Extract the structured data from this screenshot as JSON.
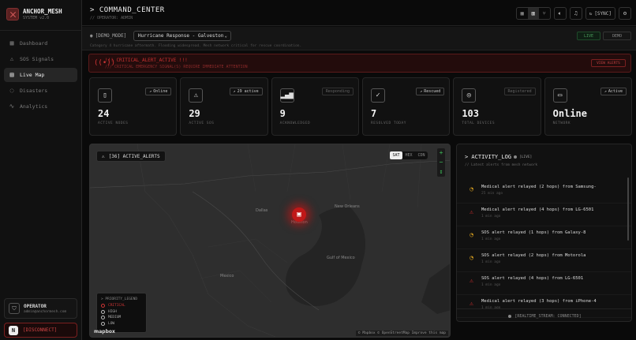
{
  "brand": {
    "name": "ANCHOR_MESH",
    "sub": "SYSTEM v2.0"
  },
  "nav": [
    {
      "label": "Dashboard",
      "icon": "grid-icon"
    },
    {
      "label": "SOS Signals",
      "icon": "warning-icon"
    },
    {
      "label": "Live Map",
      "icon": "map-icon"
    },
    {
      "label": "Disasters",
      "icon": "alert-circle-icon"
    },
    {
      "label": "Analytics",
      "icon": "activity-icon"
    }
  ],
  "operator": {
    "name": "OPERATOR",
    "email": "admin@anchormesh.com"
  },
  "disconnect": {
    "label": "[DISCONNECT]",
    "avatar": "N"
  },
  "header": {
    "title": "> COMMAND_CENTER",
    "subtitle": "// OPERATOR: ADMIN",
    "sync_label": "[SYNC]"
  },
  "demo": {
    "label": "[DEMO_MODE]",
    "selected": "Hurricane Response - Galveston",
    "description": "Category 4 hurricane aftermath. Flooding widespread. Mesh network critical for rescue coordination.",
    "live_label": "LIVE",
    "demo_btn": "DEMO"
  },
  "critical_alert": {
    "title": "!!! CRITICAL_ALERT_ACTIVE !!!",
    "subtitle": "/// CRITICAL EMERGENCY SIGNAL(S) REQUIRE IMMEDIATE ATTENTION",
    "button": "VIEW ALERTS"
  },
  "stats": [
    {
      "value": "24",
      "label": "ACTIVE NODES",
      "badge": "Online",
      "badge_dim": false,
      "icon": "phone-icon",
      "glyph": "▯"
    },
    {
      "value": "29",
      "label": "ACTIVE SOS",
      "badge": "29 active",
      "badge_dim": false,
      "icon": "warning-icon",
      "glyph": "⚠"
    },
    {
      "value": "9",
      "label": "ACKNOWLEDGED",
      "badge": "Responding",
      "badge_dim": true,
      "icon": "signal-icon",
      "glyph": "▂▄▆"
    },
    {
      "value": "7",
      "label": "RESOLVED TODAY",
      "badge": "Rescued",
      "badge_dim": false,
      "icon": "check-circle-icon",
      "glyph": "✓"
    },
    {
      "value": "103",
      "label": "TOTAL DEVICES",
      "badge": "Registered",
      "badge_dim": true,
      "icon": "globe-icon",
      "glyph": "◎"
    },
    {
      "value": "Online",
      "label": "NETWORK",
      "badge": "Active",
      "badge_dim": false,
      "icon": "video-icon",
      "glyph": "▭"
    }
  ],
  "map": {
    "alerts_label": "[36] ACTIVE_ALERTS",
    "view_modes": [
      "SAT",
      "HEX",
      "CDN"
    ],
    "legend_title": "> PRIORITY_LEGEND",
    "legend": [
      {
        "label": "CRITICAL"
      },
      {
        "label": "HIGH"
      },
      {
        "label": "MEDIUM"
      },
      {
        "label": "LOW"
      }
    ],
    "brand": "mapbox",
    "attribution": "© Mapbox © OpenStreetMap  Improve this map",
    "place_labels": [
      {
        "text": "Mexico"
      },
      {
        "text": "Gulf of Mexico"
      },
      {
        "text": "Houston"
      },
      {
        "text": "Dallas"
      },
      {
        "text": "New Orleans"
      }
    ]
  },
  "activity": {
    "title": "> ACTIVITY_LOG",
    "live": "[LIVE]",
    "subtitle": "// Latest alerts from mesh network",
    "items": [
      {
        "text": "Medical alert relayed (2 hops) from Samsung-",
        "time": "25 min ago",
        "level": "warn"
      },
      {
        "text": "Medical alert relayed (4 hops) from LG-6501",
        "time": "1 min ago",
        "level": "crit"
      },
      {
        "text": "SOS alert relayed (1 hops) from Galaxy-8",
        "time": "1 min ago",
        "level": "warn"
      },
      {
        "text": "SOS alert relayed (2 hops) from Motorola",
        "time": "1 min ago",
        "level": "warn"
      },
      {
        "text": "SOS alert relayed (4 hops) from LG-6501",
        "time": "1 min ago",
        "level": "crit"
      },
      {
        "text": "Medical alert relayed (3 hops) from iPhone-4",
        "time": "1 min ago",
        "level": "crit"
      }
    ],
    "footer": "[REALTIME_STREAM: CONNECTED]"
  }
}
